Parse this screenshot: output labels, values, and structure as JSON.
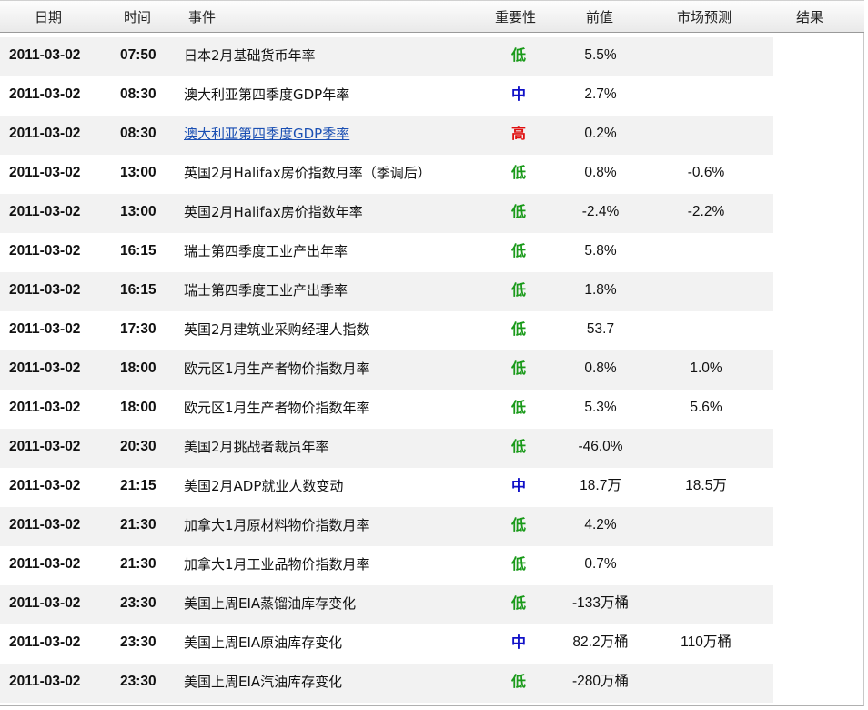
{
  "colors": {
    "low": "#1a9a1a",
    "medium": "#1010c8",
    "high": "#e01010",
    "link": "#1a4fb3"
  },
  "header": {
    "date": "日期",
    "time": "时间",
    "event": "事件",
    "importance": "重要性",
    "previous": "前值",
    "forecast": "市场预测",
    "result": "结果"
  },
  "rows": [
    {
      "date": "2011-03-02",
      "time": "07:50",
      "event": "日本2月基础货币年率",
      "importance": "低",
      "level": "low",
      "previous": "5.5%",
      "forecast": "",
      "result": "",
      "link": false
    },
    {
      "date": "2011-03-02",
      "time": "08:30",
      "event": "澳大利亚第四季度GDP年率",
      "importance": "中",
      "level": "medium",
      "previous": "2.7%",
      "forecast": "",
      "result": "",
      "link": false
    },
    {
      "date": "2011-03-02",
      "time": "08:30",
      "event": "澳大利亚第四季度GDP季率",
      "importance": "高",
      "level": "high",
      "previous": "0.2%",
      "forecast": "",
      "result": "",
      "link": true
    },
    {
      "date": "2011-03-02",
      "time": "13:00",
      "event": "英国2月Halifax房价指数月率（季调后）",
      "importance": "低",
      "level": "low",
      "previous": "0.8%",
      "forecast": "-0.6%",
      "result": "",
      "link": false
    },
    {
      "date": "2011-03-02",
      "time": "13:00",
      "event": "英国2月Halifax房价指数年率",
      "importance": "低",
      "level": "low",
      "previous": "-2.4%",
      "forecast": "-2.2%",
      "result": "",
      "link": false
    },
    {
      "date": "2011-03-02",
      "time": "16:15",
      "event": "瑞士第四季度工业产出年率",
      "importance": "低",
      "level": "low",
      "previous": "5.8%",
      "forecast": "",
      "result": "",
      "link": false
    },
    {
      "date": "2011-03-02",
      "time": "16:15",
      "event": "瑞士第四季度工业产出季率",
      "importance": "低",
      "level": "low",
      "previous": "1.8%",
      "forecast": "",
      "result": "",
      "link": false
    },
    {
      "date": "2011-03-02",
      "time": "17:30",
      "event": "英国2月建筑业采购经理人指数",
      "importance": "低",
      "level": "low",
      "previous": "53.7",
      "forecast": "",
      "result": "",
      "link": false
    },
    {
      "date": "2011-03-02",
      "time": "18:00",
      "event": "欧元区1月生产者物价指数月率",
      "importance": "低",
      "level": "low",
      "previous": "0.8%",
      "forecast": "1.0%",
      "result": "",
      "link": false
    },
    {
      "date": "2011-03-02",
      "time": "18:00",
      "event": "欧元区1月生产者物价指数年率",
      "importance": "低",
      "level": "low",
      "previous": "5.3%",
      "forecast": "5.6%",
      "result": "",
      "link": false
    },
    {
      "date": "2011-03-02",
      "time": "20:30",
      "event": "美国2月挑战者裁员年率",
      "importance": "低",
      "level": "low",
      "previous": "-46.0%",
      "forecast": "",
      "result": "",
      "link": false
    },
    {
      "date": "2011-03-02",
      "time": "21:15",
      "event": "美国2月ADP就业人数变动",
      "importance": "中",
      "level": "medium",
      "previous": "18.7万",
      "forecast": "18.5万",
      "result": "",
      "link": false
    },
    {
      "date": "2011-03-02",
      "time": "21:30",
      "event": "加拿大1月原材料物价指数月率",
      "importance": "低",
      "level": "low",
      "previous": "4.2%",
      "forecast": "",
      "result": "",
      "link": false
    },
    {
      "date": "2011-03-02",
      "time": "21:30",
      "event": "加拿大1月工业品物价指数月率",
      "importance": "低",
      "level": "low",
      "previous": "0.7%",
      "forecast": "",
      "result": "",
      "link": false
    },
    {
      "date": "2011-03-02",
      "time": "23:30",
      "event": "美国上周EIA蒸馏油库存变化",
      "importance": "低",
      "level": "low",
      "previous": "-133万桶",
      "forecast": "",
      "result": "",
      "link": false
    },
    {
      "date": "2011-03-02",
      "time": "23:30",
      "event": "美国上周EIA原油库存变化",
      "importance": "中",
      "level": "medium",
      "previous": "82.2万桶",
      "forecast": "110万桶",
      "result": "",
      "link": false
    },
    {
      "date": "2011-03-02",
      "time": "23:30",
      "event": "美国上周EIA汽油库存变化",
      "importance": "低",
      "level": "low",
      "previous": "-280万桶",
      "forecast": "",
      "result": "",
      "link": false
    }
  ]
}
